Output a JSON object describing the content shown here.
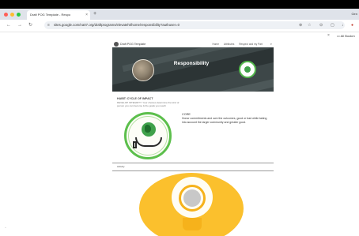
{
  "browser": {
    "tab_title": "Draft POG Template - Respo",
    "tab_close": "×",
    "new_tab": "+",
    "top_right_label": "Gen",
    "url": "sites.google.com/na07.org/draftprograms/elevateht/home/responsibility?authuser=0",
    "all_bookmarks": "All Bookm",
    "colors": {
      "close": "#ff5f57",
      "minimize": "#febc2e",
      "maximize": "#28c840"
    }
  },
  "site": {
    "title": "Draft POG Template",
    "nav": [
      "Home",
      "Attributes",
      "Respect and my Part"
    ],
    "search_icon": "search-icon"
  },
  "banner": {
    "title": "Responsibility"
  },
  "habit": {
    "title": "HABIT: CYCLE OF IMPACT",
    "subtitle_line1": "DEVELOP INTEGRITY: Your choices determine the kind of",
    "subtitle_line2": "person you can become & the goals you reach"
  },
  "core": {
    "title": "CORE",
    "body_line1": "Honor commitments and own the outcomes, good or bad while taking",
    "body_line2": "into account the larger community and greater good."
  },
  "activity": {
    "label": "Activity"
  },
  "colors": {
    "accent_green": "#5cbf4c",
    "banner_gray": "#3d4748",
    "bulb_yellow": "#fbc02d"
  }
}
